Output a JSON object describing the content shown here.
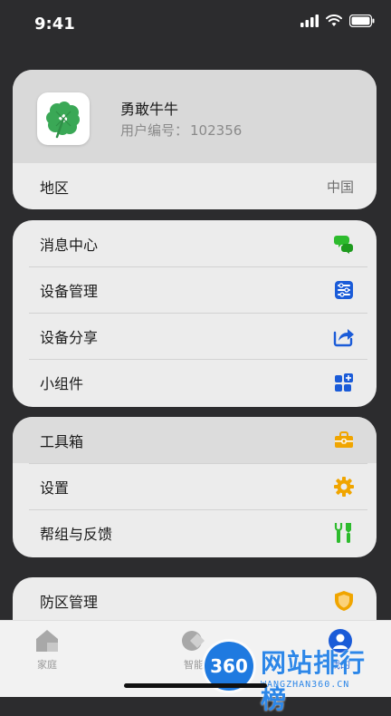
{
  "status_bar": {
    "time": "9:41"
  },
  "profile": {
    "name": "勇敢牛牛",
    "id_label": "用户编号：",
    "id_value": "102356",
    "avatar_icon": "four-leaf-clover-icon"
  },
  "region": {
    "label": "地区",
    "value": "中国"
  },
  "menu1": [
    {
      "label": "消息中心",
      "icon": "chat-bubble-icon",
      "color": "#2dbb2d"
    },
    {
      "label": "设备管理",
      "icon": "device-manage-icon",
      "color": "#1a5bd8"
    },
    {
      "label": "设备分享",
      "icon": "share-icon",
      "color": "#1a5bd8"
    },
    {
      "label": "小组件",
      "icon": "widget-grid-icon",
      "color": "#1a5bd8"
    }
  ],
  "menu2": [
    {
      "label": "工具箱",
      "icon": "toolbox-icon",
      "color": "#f0a500"
    },
    {
      "label": "设置",
      "icon": "gear-icon",
      "color": "#f0a500"
    },
    {
      "label": "帮组与反馈",
      "icon": "tools-icon",
      "color": "#2dbb2d"
    }
  ],
  "menu3": [
    {
      "label": "防区管理",
      "icon": "shield-icon",
      "color": "#f0a500"
    }
  ],
  "tabbar": {
    "home": "家庭",
    "smart": "智能",
    "mine": "我的",
    "active_color": "#1a5bd8"
  },
  "watermark": {
    "badge": "360",
    "title": "网站排行榜",
    "subtitle": "WANGZHAN360.CN"
  }
}
